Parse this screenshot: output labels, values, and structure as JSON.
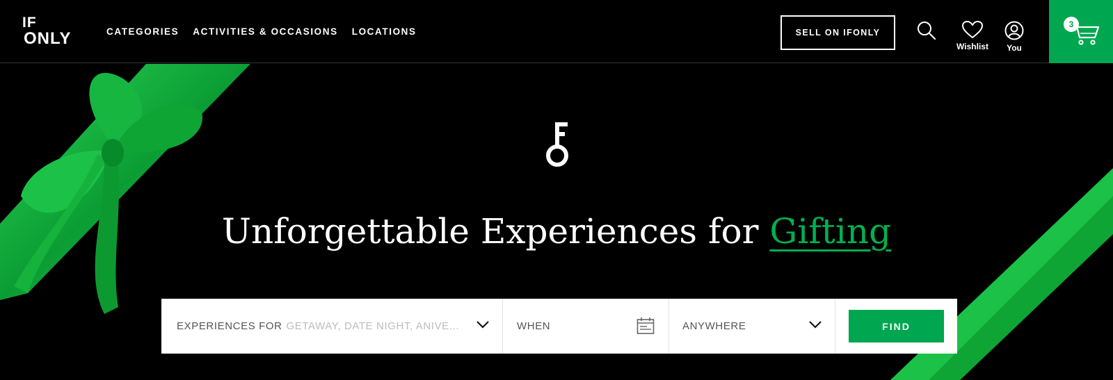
{
  "brand": {
    "logo_line1": "IF",
    "logo_line2": "ONLY",
    "accent_color": "#00a650"
  },
  "nav": {
    "links": [
      "CATEGORIES",
      "ACTIVITIES & OCCASIONS",
      "LOCATIONS"
    ],
    "sell_label": "SELL ON IFONLY",
    "search_icon": "search-icon",
    "wishlist_label": "Wishlist",
    "you_label": "You",
    "cart_count": "3"
  },
  "hero": {
    "headline_main": "Unforgettable Experiences for ",
    "headline_accent": "Gifting"
  },
  "search": {
    "experiences_label": "EXPERIENCES FOR",
    "experiences_placeholder": "GETAWAY, DATE NIGHT, ANIVE...",
    "when_label": "WHEN",
    "where_label": "ANYWHERE",
    "find_label": "FIND"
  }
}
